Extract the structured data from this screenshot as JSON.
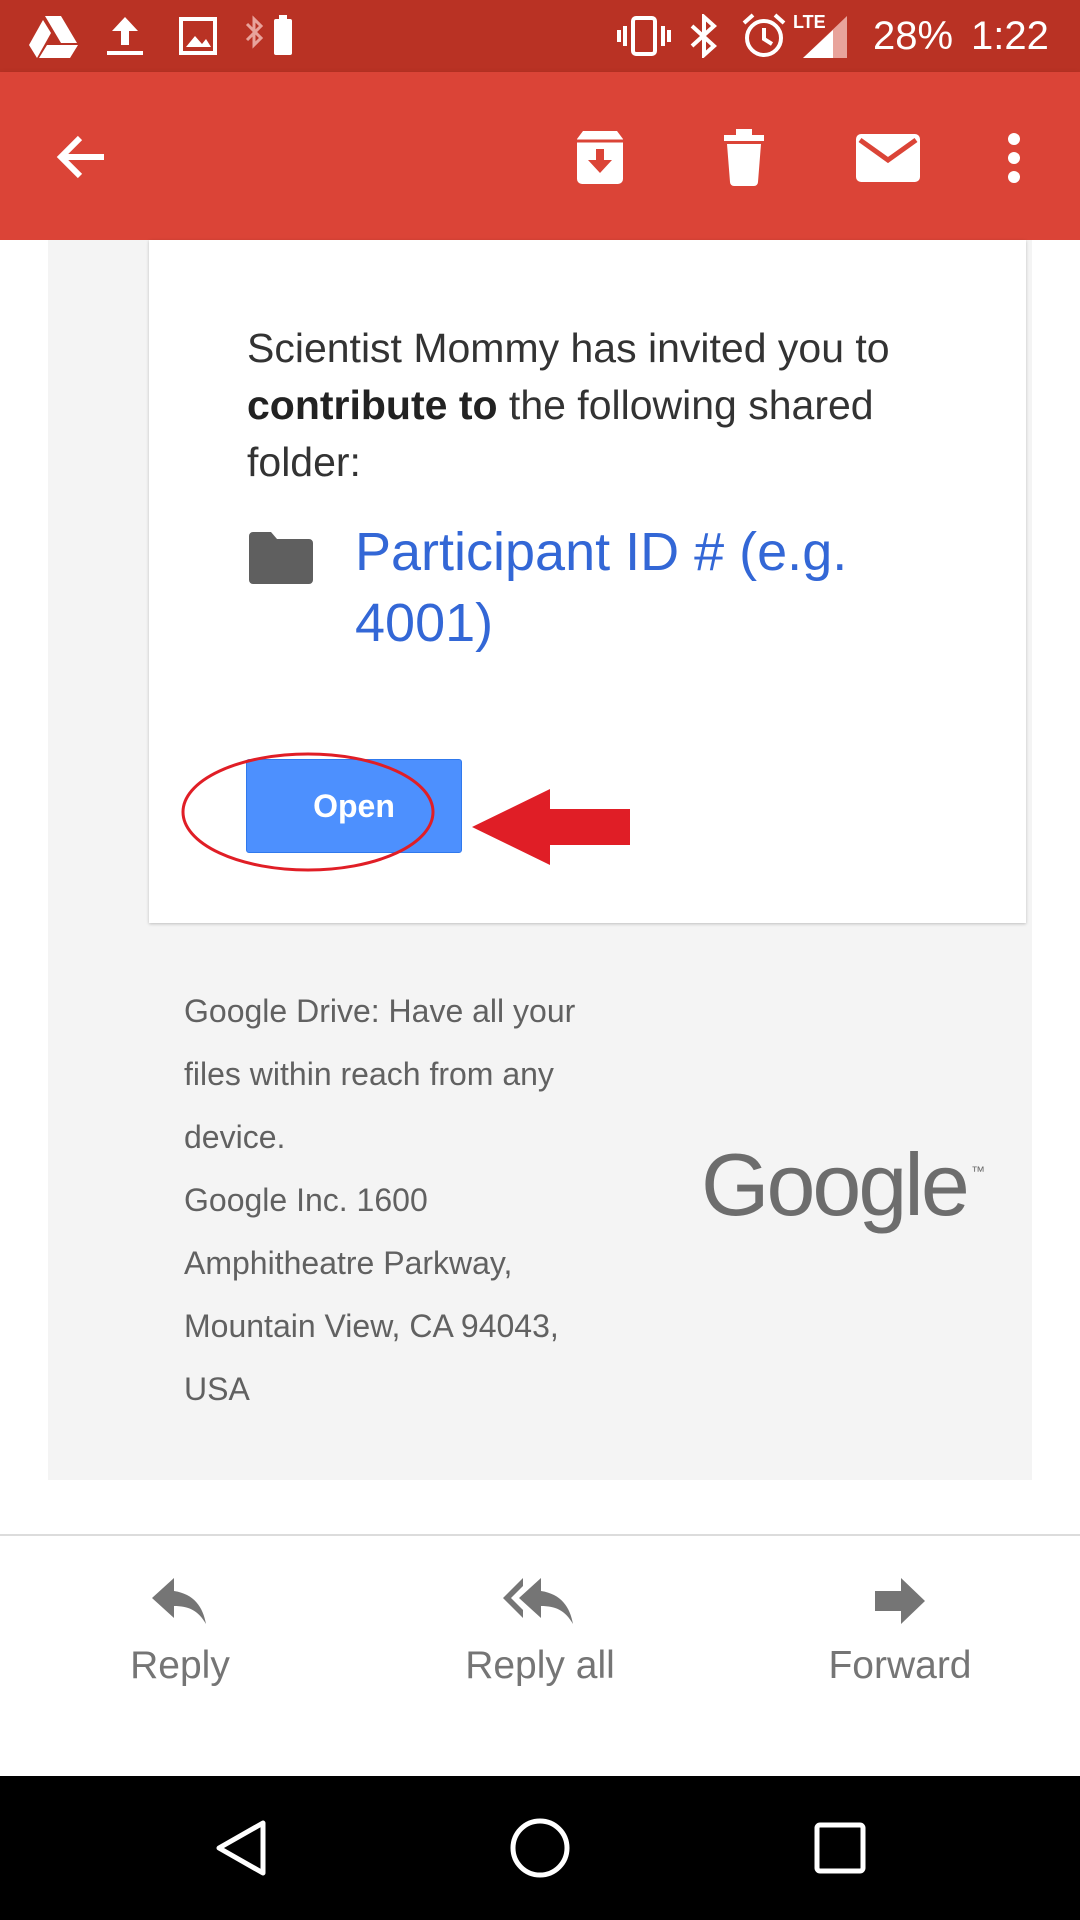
{
  "status_bar": {
    "battery": "28%",
    "time": "1:22",
    "network": "LTE",
    "icons": [
      "drive-icon",
      "upload-icon",
      "image-icon",
      "bluetooth-battery-icon",
      "vibrate-icon",
      "bluetooth-icon",
      "alarm-icon",
      "signal-icon"
    ]
  },
  "toolbar": {
    "icons": [
      "back-arrow-icon",
      "archive-icon",
      "delete-icon",
      "mark-unread-icon",
      "more-vert-icon"
    ],
    "accent": "#db4437"
  },
  "email": {
    "intro_pre": "Scientist Mommy has invited you to ",
    "intro_bold": "contribute to",
    "intro_post": " the following shared folder:",
    "folder_name": "Participant ID # (e.g. 4001)",
    "open_button": "Open",
    "footer_line1": "Google Drive: Have all your files within reach from any device.",
    "footer_line2": "Google Inc. 1600 Amphitheatre Parkway, Mountain View, CA 94043, USA",
    "logo_text": "Google",
    "logo_tm": "™"
  },
  "actions": {
    "reply": "Reply",
    "reply_all": "Reply all",
    "forward": "Forward"
  },
  "nav": {
    "icons": [
      "back-triangle-icon",
      "home-circle-icon",
      "recents-square-icon"
    ]
  },
  "colors": {
    "status_bar": "#b93224",
    "app_bar": "#db4437",
    "link": "#3367d6",
    "button": "#4d90fe",
    "annotation": "#e01e26"
  }
}
